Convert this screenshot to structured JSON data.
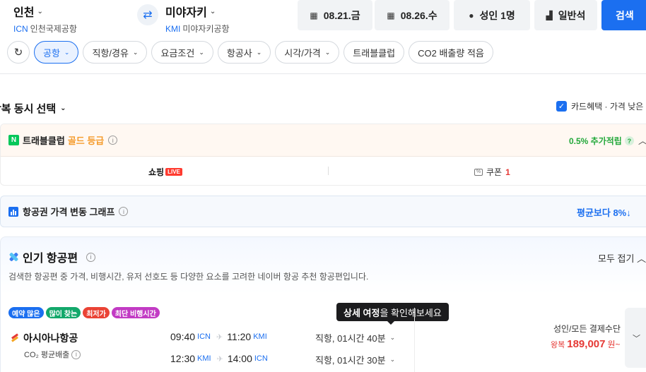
{
  "search": {
    "origin": {
      "city": "인천",
      "code": "ICN",
      "airport": "인천국제공항"
    },
    "destination": {
      "city": "미야자키",
      "code": "KMI",
      "airport": "미야자키공항"
    },
    "depart_date": "08.21.금",
    "return_date": "08.26.수",
    "passengers": "성인 1명",
    "seat_class": "일반석",
    "search_label": "검색"
  },
  "filters": {
    "chips": [
      {
        "label": "공항",
        "active": true
      },
      {
        "label": "직항/경유",
        "active": false
      },
      {
        "label": "요금조건",
        "active": false
      },
      {
        "label": "항공사",
        "active": false
      },
      {
        "label": "시각/가격",
        "active": false
      },
      {
        "label": "트래블클럽",
        "active": false,
        "no_chevron": true
      },
      {
        "label": "CO2 배출량 적음",
        "active": false,
        "no_chevron": true
      }
    ]
  },
  "selection": {
    "mode": "왕복 동시 선택",
    "card_option": "카드혜택 · 가격 낮은 순"
  },
  "travel_club": {
    "logo": "N",
    "title": "트래블클럽",
    "grade": "골드 등급",
    "extra": "0.5% 추가적립",
    "shopping": "쇼핑",
    "live": "LIVE",
    "coupon_label": "쿠폰",
    "coupon_count": "1"
  },
  "price_graph": {
    "title": "항공권 가격 변동 그래프",
    "avg_text": "평균보다 8%↓"
  },
  "popular": {
    "title": "인기 항공편",
    "collapse": "모두 접기",
    "description": "검색한 항공편 중 가격, 비행시간, 유저 선호도 등 다양한 요소를 고려한 네이버 항공 추천 항공편입니다.",
    "badges": [
      {
        "label": "예약 많은",
        "color": "#1b6ff0"
      },
      {
        "label": "많이 찾는",
        "color": "#13a86b"
      },
      {
        "label": "최저가",
        "color": "#ea4335"
      },
      {
        "label": "최단 비행시간",
        "color": "#c23bc4"
      }
    ],
    "tooltip_bold": "상세 여정",
    "tooltip_rest": "을 확인해보세요",
    "flight": {
      "airline": "아시아나항공",
      "co2": "CO₂ 평균배출",
      "segments": [
        {
          "dep_time": "09:40",
          "dep_code": "ICN",
          "arr_time": "11:20",
          "arr_code": "KMI",
          "duration": "직항, 01시간 40분"
        },
        {
          "dep_time": "12:30",
          "dep_code": "KMI",
          "arr_time": "14:00",
          "arr_code": "ICN",
          "duration": "직항, 01시간 30분"
        }
      ],
      "payment_label": "성인/모든 결제수단",
      "roundtrip_label": "왕복",
      "price": "189,007",
      "currency": "원~"
    }
  }
}
